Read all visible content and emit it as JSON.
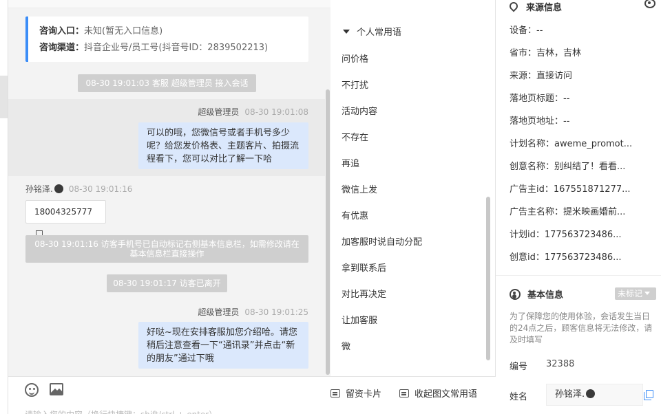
{
  "chat": {
    "entry": [
      {
        "key": "咨询入口：",
        "value": "未知(暂无入口信息)"
      },
      {
        "key": "咨询渠道：",
        "value": "抖音企业号/员工号(抖音号ID：2839502213)"
      }
    ],
    "system_join": "08-30 19:01:03 客服 超级管理员 接入会话",
    "msg1": {
      "name": "超级管理员",
      "time": "08-30 19:01:08",
      "text": "可以的哦，您微信号或者手机号多少呢？给您发价格表、主题客片、拍摄流程看下，您可以对比了解一下哈"
    },
    "msg2": {
      "name": "孙铭泽.",
      "time": "08-30 19:01:16",
      "text": "18004325777"
    },
    "system_phone": "08-30 19:01:16 访客手机号已自动标记右侧基本信息栏，如需修改请在基本信息栏直接操作",
    "system_leave": "08-30 19:01:17 访客已离开",
    "msg3": {
      "name": "超级管理员",
      "time": "08-30 19:01:25",
      "text": "好哒~现在安排客服加您介绍哈。请您稍后注意查看一下“通讯录”并点击“新的朋友”通过下哦"
    },
    "input_placeholder": "请输入您的内容（换行快捷键：shift/ctrl + enter）"
  },
  "phrases": {
    "header": "个人常用语",
    "items": [
      "问价格",
      "不打扰",
      "活动内容",
      "不存在",
      "再追",
      "微信上发",
      "有优惠",
      "加客服时说自动分配",
      "拿到联系后",
      "对比再决定",
      "让加客服",
      "微"
    ],
    "footer_card": "留资卡片",
    "footer_collapse": "收起图文常用语"
  },
  "source": {
    "title": "来源信息",
    "rows": [
      "设备：--",
      "省市：吉林，吉林",
      "来源：直接访问",
      "落地页标题：--",
      "落地页地址：--",
      "计划名称：aweme_promot...",
      "创意名称：别纠结了！看看...",
      "广告主id：167551871277...",
      "广告主名称：提米映画婚前...",
      "计划id：177563723486...",
      "创意id：177563723486..."
    ]
  },
  "basic": {
    "title": "基本信息",
    "tag": "未标记",
    "notice": "为了保障您的使用体验，会话发生当日的24点之后，顾客信息将无法修改，请及时填写",
    "id_label": "编号",
    "id_value": "32388",
    "name_label": "姓名",
    "name_value": "孙铭泽."
  },
  "colors": {
    "accent": "#3b8df7",
    "bubble": "#dbe8fc",
    "system": "#cfcfcf"
  }
}
